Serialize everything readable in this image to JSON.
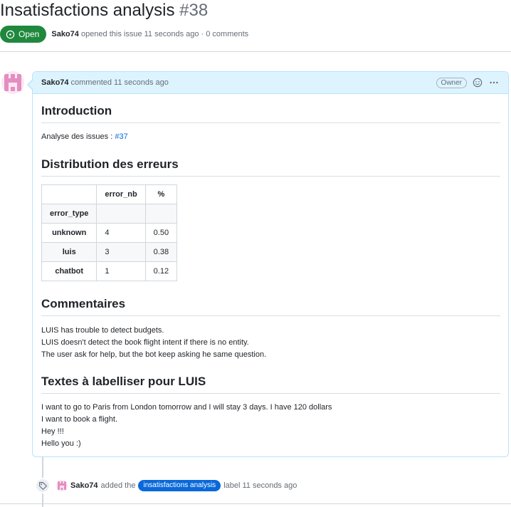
{
  "issue": {
    "title": "Insatisfactions analysis",
    "number": "#38",
    "state": "Open",
    "author": "Sako74",
    "opened_text": "opened this issue 11 seconds ago · 0 comments"
  },
  "comment": {
    "author": "Sako74",
    "time_text": "commented 11 seconds ago",
    "owner_badge": "Owner",
    "sections": {
      "intro": {
        "heading": "Introduction",
        "text": "Analyse des issues : ",
        "link": "#37"
      },
      "distribution": {
        "heading": "Distribution des erreurs",
        "table": {
          "columns": [
            "",
            "error_nb",
            "%"
          ],
          "index_name": "error_type",
          "rows": [
            {
              "label": "unknown",
              "error_nb": "4",
              "pct": "0.50"
            },
            {
              "label": "luis",
              "error_nb": "3",
              "pct": "0.38"
            },
            {
              "label": "chatbot",
              "error_nb": "1",
              "pct": "0.12"
            }
          ]
        }
      },
      "comments": {
        "heading": "Commentaires",
        "lines": [
          "LUIS has trouble to detect budgets.",
          "LUIS doesn't detect the book flight intent if there is no entity.",
          "The user ask for help, but the bot keep asking he same question."
        ]
      },
      "texts": {
        "heading": "Textes à labelliser pour LUIS",
        "lines": [
          "I want to go to Paris from London tomorrow and I will stay 3 days. I have 120 dollars",
          "I want to book a flight.",
          "Hey !!!",
          "Hello you :)"
        ]
      }
    }
  },
  "timeline": {
    "event_author": "Sako74",
    "event_action": "added the",
    "label": "insatisfactions analysis",
    "event_suffix": "label 11 seconds ago"
  },
  "icons": {
    "state": "issue-opened-icon",
    "emoji": "smiley-icon",
    "menu": "kebab-horizontal-icon",
    "tag": "tag-icon"
  },
  "colors": {
    "open_green": "#1f883d",
    "link_blue": "#0969da",
    "comment_header_bg": "#ddf4ff",
    "comment_border": "#b6e3ff",
    "avatar_pink": "#e38ec2"
  }
}
